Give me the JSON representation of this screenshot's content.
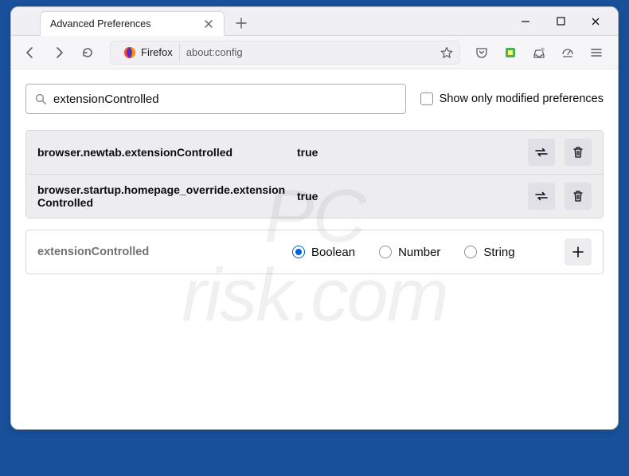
{
  "tab_title": "Advanced Preferences",
  "urlbar": {
    "identity_label": "Firefox",
    "url": "about:config"
  },
  "search": {
    "value": "extensionControlled"
  },
  "show_only_modified_label": "Show only modified preferences",
  "prefs": [
    {
      "name": "browser.newtab.extensionControlled",
      "value": "true"
    },
    {
      "name": "browser.startup.homepage_override.extensionControlled",
      "value": "true"
    }
  ],
  "new_pref": {
    "name": "extensionControlled",
    "types": [
      "Boolean",
      "Number",
      "String"
    ],
    "selected": "Boolean"
  },
  "watermark": "PC\nrisk.com"
}
